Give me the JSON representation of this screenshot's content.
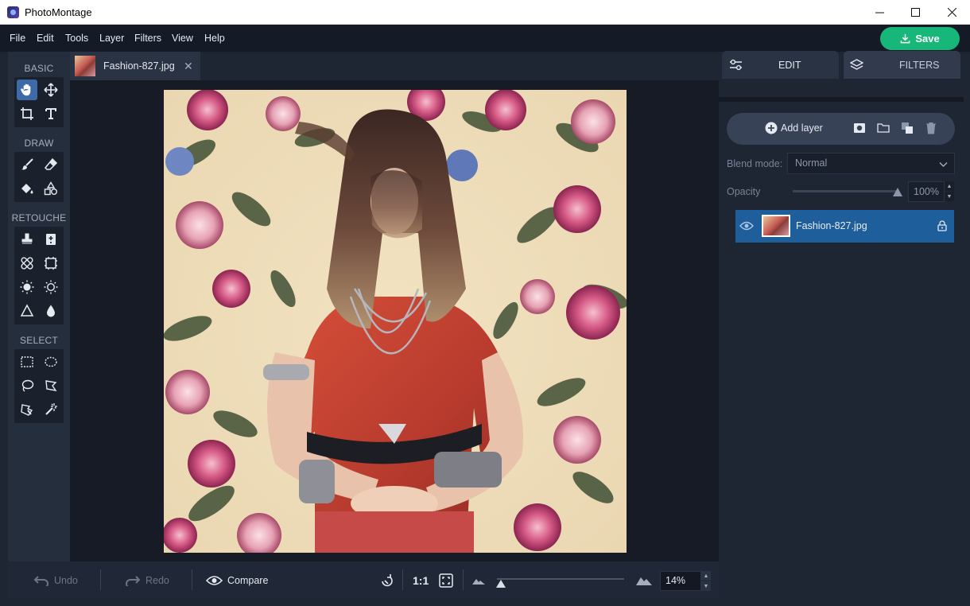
{
  "window": {
    "title": "PhotoMontage"
  },
  "menu": [
    "File",
    "Edit",
    "Tools",
    "Layer",
    "Filters",
    "View",
    "Help"
  ],
  "save_label": "Save",
  "toolbar": {
    "sections": [
      "BASIC",
      "DRAW",
      "RETOUCHE",
      "SELECT"
    ],
    "tools": {
      "basic": [
        "hand-tool",
        "move-tool",
        "crop-tool",
        "text-tool"
      ],
      "draw": [
        "brush-tool",
        "eraser-tool",
        "fill-tool",
        "shapes-tool"
      ],
      "retouche": [
        "clone-stamp-tool",
        "healing-brush-tool",
        "patch-tool",
        "content-aware-tool",
        "dodge-tool",
        "burn-tool",
        "sharpen-tool",
        "blur-tool"
      ],
      "select": [
        "rectangle-select-tool",
        "ellipse-select-tool",
        "lasso-tool",
        "polygon-lasso-tool",
        "magnetic-lasso-tool",
        "magic-wand-tool"
      ]
    },
    "active_tool": "hand-tool"
  },
  "document_tab": {
    "filename": "Fashion-827.jpg"
  },
  "bottom_bar": {
    "undo": "Undo",
    "redo": "Redo",
    "compare": "Compare",
    "actual_size": "1:1",
    "zoom_value": "14%",
    "zoom_fraction": 0.0
  },
  "right_panel": {
    "tabs": [
      "EDIT",
      "FILTERS"
    ],
    "active_tab": "EDIT",
    "add_layer": "Add layer",
    "blend_mode_label": "Blend mode:",
    "blend_mode_value": "Normal",
    "opacity_label": "Opacity",
    "opacity_value": "100%",
    "opacity_fraction": 1.0,
    "layers": [
      {
        "name": "Fashion-827.jpg",
        "visible": true,
        "locked": true,
        "selected": true
      }
    ]
  },
  "colors": {
    "accent_save": "#16b779",
    "selected_layer": "#1e5e9b",
    "active_tool": "#3e6ba8",
    "panel_bg": "#1e2533"
  }
}
